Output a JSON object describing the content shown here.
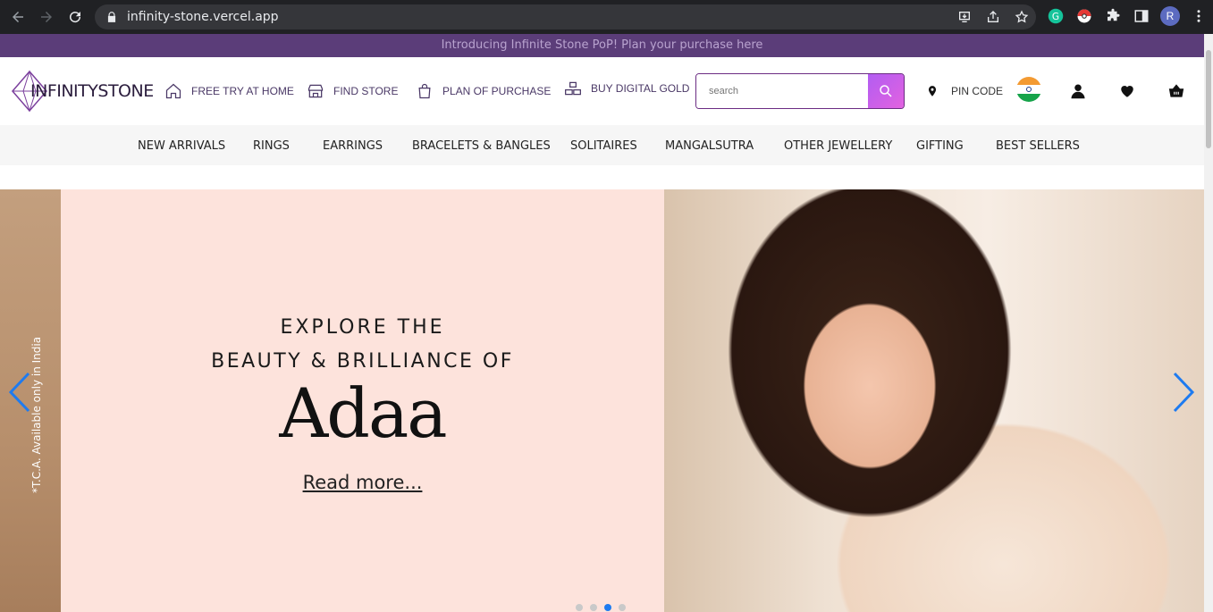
{
  "browser": {
    "url": "infinity-stone.vercel.app",
    "profile_initial": "R"
  },
  "announcement": "Introducing Infinite Stone PoP! Plan your purchase here",
  "header": {
    "logo_text": "INFINITYSTONE",
    "links": [
      {
        "label": "FREE TRY AT HOME",
        "icon": "home-icon"
      },
      {
        "label": "FIND STORE",
        "icon": "store-icon"
      },
      {
        "label": "PLAN OF PURCHASE",
        "icon": "bag-icon"
      },
      {
        "label": "BUY DIGITAL GOLD",
        "icon": "gold-bars-icon"
      }
    ],
    "search_placeholder": "search",
    "pin_code_label": "PIN CODE"
  },
  "categories": [
    "NEW ARRIVALS",
    "RINGS",
    "EARRINGS",
    "BRACELETS & BANGLES",
    "SOLITAIRES",
    "MANGALSUTRA",
    "OTHER JEWELLERY",
    "GIFTING",
    "BEST SELLERS"
  ],
  "hero": {
    "line1": "EXPLORE THE",
    "line2": "BEAUTY & BRILLIANCE OF",
    "brand": "Adaa",
    "cta": "Read more...",
    "side_note": "*T.C.A. Available only in India",
    "slide_count": 4,
    "active_slide": 3
  },
  "colors": {
    "announcement_bg": "#5b3d79",
    "accent": "#6b2c83",
    "hero_pink": "#fde3dc",
    "arrow_blue": "#1e7bf0"
  }
}
